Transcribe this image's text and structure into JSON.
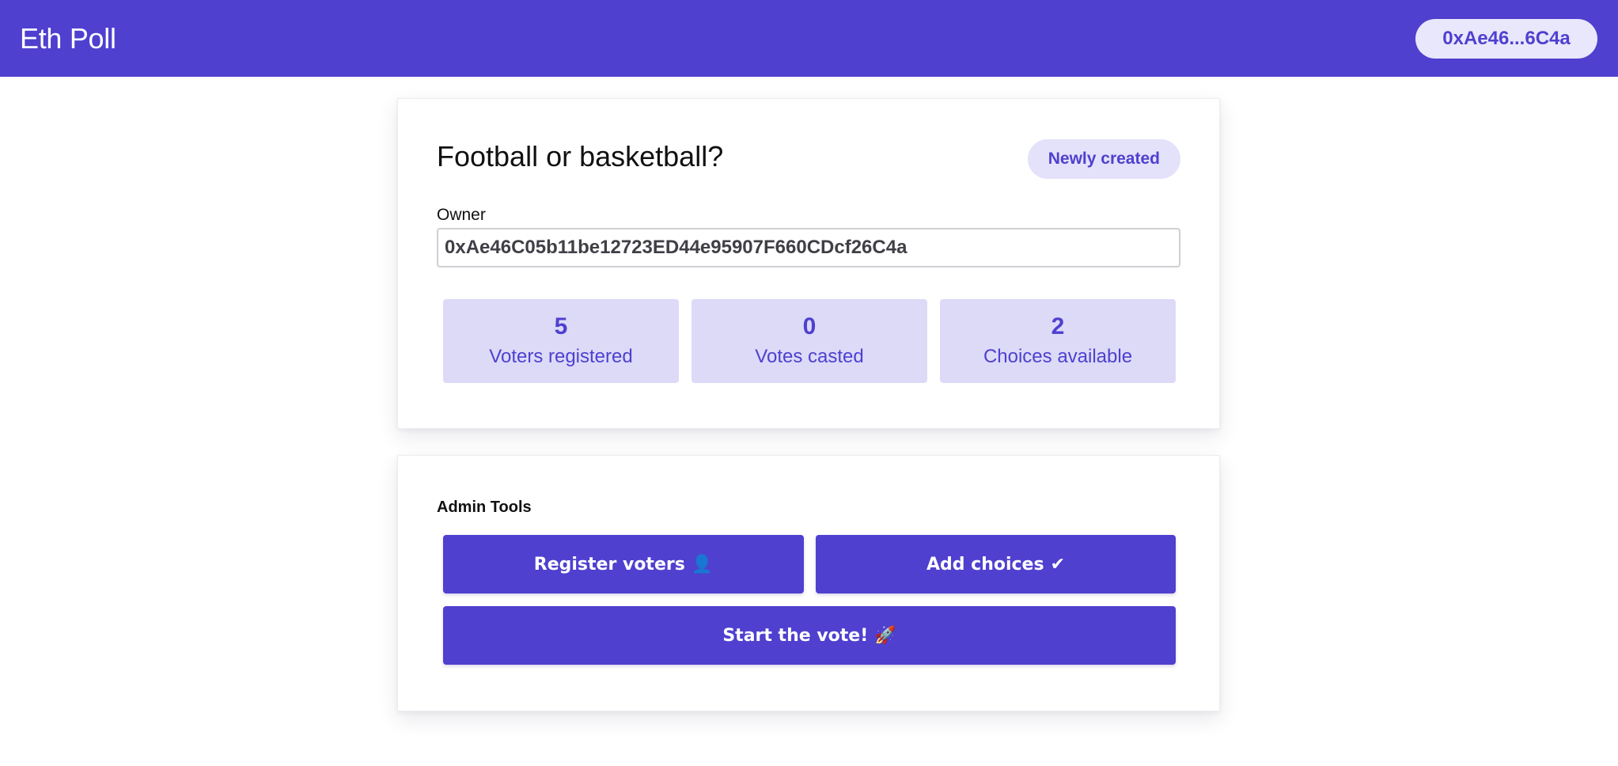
{
  "app": {
    "title": "Eth Poll",
    "account_short": "0xAe46...6C4a"
  },
  "poll": {
    "question": "Football or basketball?",
    "status": "Newly created",
    "owner_label": "Owner",
    "owner_address": "0xAe46C05b11be12723ED44e95907F660CDcf26C4a",
    "stats": [
      {
        "value": "5",
        "label": "Voters registered"
      },
      {
        "value": "0",
        "label": "Votes casted"
      },
      {
        "value": "2",
        "label": "Choices available"
      }
    ]
  },
  "admin": {
    "title": "Admin Tools",
    "register_label": "Register voters",
    "register_icon": "👤",
    "add_choices_label": "Add choices",
    "add_choices_icon": "✔",
    "start_label": "Start the vote!",
    "start_icon": "🚀"
  },
  "colors": {
    "brand": "#4f40cf",
    "badge_bg": "#e4e1fa",
    "stat_bg": "#dcdaf7"
  }
}
